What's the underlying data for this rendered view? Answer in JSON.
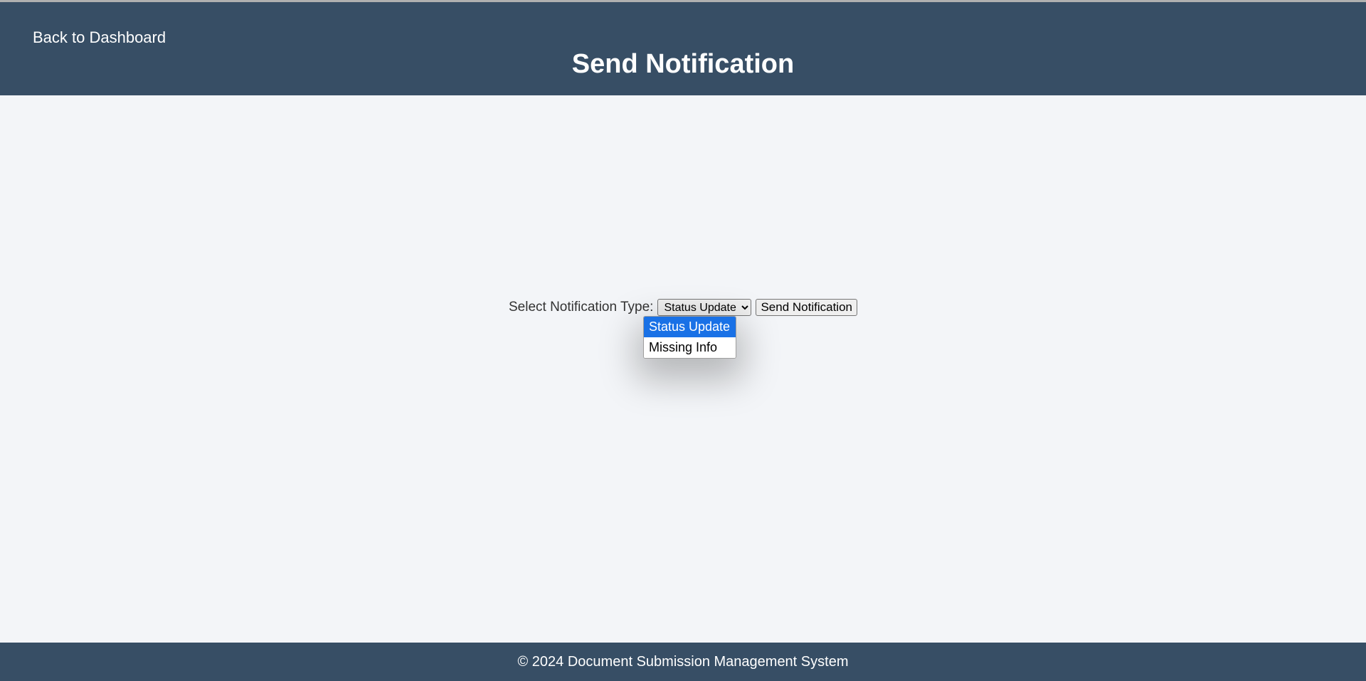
{
  "header": {
    "back_link": "Back to Dashboard",
    "title": "Send Notification"
  },
  "form": {
    "label": "Select Notification Type:",
    "select_display": "Status Update",
    "options": [
      "Status Update",
      "Missing Info"
    ],
    "submit_label": "Send Notification"
  },
  "footer": {
    "copyright": "© 2024 Document Submission Management System"
  }
}
